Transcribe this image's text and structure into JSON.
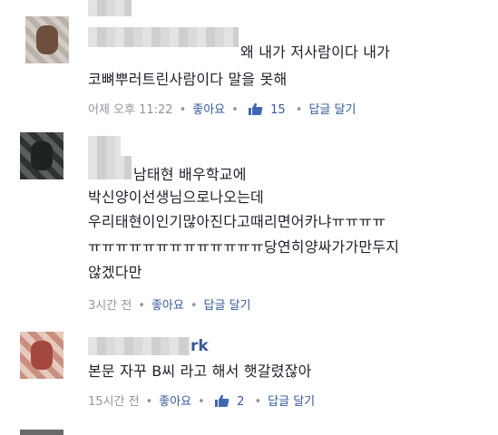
{
  "comments": [
    {
      "name_tail": "",
      "lines": [
        "왜 내가 저사람이다 내가",
        "코뼈뿌러트린사람이다 말을 못해"
      ],
      "time": "어제 오후 11:22",
      "like_label": "좋아요",
      "like_count": "15",
      "reply_label": "답글 달기"
    },
    {
      "name_tail": "",
      "lines": [
        "남태현 배우학교에",
        "박신양이선생님으로나오는데",
        "우리태현이인기많아진다고때리면어카냐ㅠㅠㅠㅠ",
        "ㅠㅠㅠㅠㅠㅠㅠㅠㅠㅠㅠㅠㅠ당연히양싸가가만두지",
        "않겠다만"
      ],
      "time": "3시간 전",
      "like_label": "좋아요",
      "like_count": "",
      "reply_label": "답글 달기"
    },
    {
      "name_tail": "rk",
      "lines": [
        "본문 자꾸 B씨 라고 해서 햇갈렸잖아"
      ],
      "time": "15시간 전",
      "like_label": "좋아요",
      "like_count": "2",
      "reply_label": "답글 달기"
    }
  ],
  "icons": {
    "like": "thumbs-up-icon"
  },
  "colors": {
    "link": "#365899",
    "meta": "#90949c",
    "text": "#1d2129"
  }
}
